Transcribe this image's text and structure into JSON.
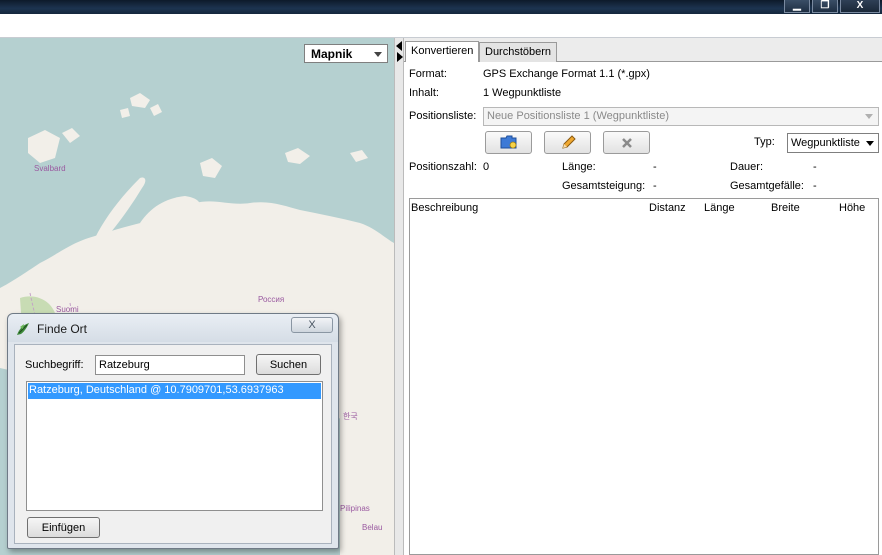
{
  "window": {
    "minimize_glyph": "▁",
    "restore_glyph": "❐",
    "close_glyph": "X"
  },
  "map": {
    "provider": "Mapnik",
    "labels": {
      "svalbard": "Svalbard",
      "russia": "Россия",
      "suomi": "Suomi",
      "korea": "한국",
      "philippines": "Pilipinas",
      "palau": "Belau"
    }
  },
  "tabs": [
    {
      "label": "Konvertieren",
      "active": true
    },
    {
      "label": "Durchstöbern",
      "active": false
    }
  ],
  "info": {
    "format_label": "Format:",
    "format_value": "GPS Exchange Format 1.1 (*.gpx)",
    "content_label": "Inhalt:",
    "content_value": "1 Wegpunktliste",
    "poslist_label": "Positionsliste:",
    "poslist_value": "Neue Positionsliste 1 (Wegpunktliste)",
    "type_label": "Typ:",
    "type_value": "Wegpunktliste"
  },
  "stats": {
    "count_label": "Positionszahl:",
    "count_value": "0",
    "length_label": "Länge:",
    "length_value": "-",
    "duration_label": "Dauer:",
    "duration_value": "-",
    "ascent_label": "Gesamtsteigung:",
    "ascent_value": "-",
    "descent_label": "Gesamtgefälle:",
    "descent_value": "-"
  },
  "table": {
    "columns": [
      "Beschreibung",
      "Distanz",
      "Länge",
      "Breite",
      "Höhe"
    ],
    "rows": []
  },
  "dialog": {
    "title": "Finde Ort",
    "close_glyph": "X",
    "search_label": "Suchbegriff:",
    "search_value": "Ratzeburg",
    "search_button": "Suchen",
    "results": [
      "Ratzeburg, Deutschland @ 10.7909701,53.6937963"
    ],
    "insert_button": "Einfügen"
  },
  "colors": {
    "sea": "#b5d0d0",
    "land": "#f2efe9",
    "forest": "#c8dcb4",
    "selection": "#3399ff"
  }
}
